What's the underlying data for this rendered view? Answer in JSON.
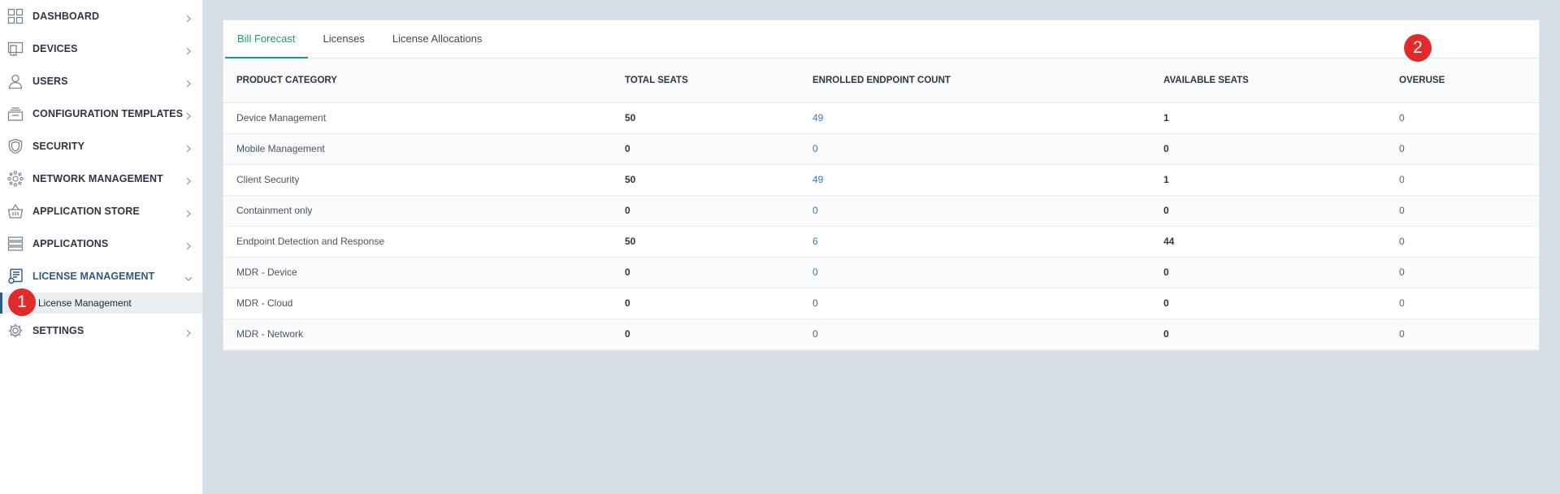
{
  "sidebar": {
    "items": [
      {
        "label": "DASHBOARD",
        "icon": "dashboard-icon"
      },
      {
        "label": "DEVICES",
        "icon": "devices-icon"
      },
      {
        "label": "USERS",
        "icon": "user-icon"
      },
      {
        "label": "CONFIGURATION TEMPLATES",
        "icon": "templates-icon"
      },
      {
        "label": "SECURITY",
        "icon": "shield-icon"
      },
      {
        "label": "NETWORK MANAGEMENT",
        "icon": "network-icon"
      },
      {
        "label": "APPLICATION STORE",
        "icon": "basket-icon"
      },
      {
        "label": "APPLICATIONS",
        "icon": "applications-icon"
      },
      {
        "label": "LICENSE MANAGEMENT",
        "icon": "license-icon"
      },
      {
        "label": "SETTINGS",
        "icon": "gear-icon"
      }
    ],
    "sub_item": {
      "label": "License Management"
    }
  },
  "badges": {
    "one": "1",
    "two": "2"
  },
  "tabs": [
    {
      "label": "Bill Forecast",
      "active": true
    },
    {
      "label": "Licenses",
      "active": false
    },
    {
      "label": "License Allocations",
      "active": false
    }
  ],
  "table": {
    "headers": [
      "PRODUCT CATEGORY",
      "TOTAL SEATS",
      "ENROLLED ENDPOINT COUNT",
      "AVAILABLE SEATS",
      "OVERUSE"
    ],
    "rows": [
      [
        "Device Management",
        "50",
        "49",
        "1",
        "0"
      ],
      [
        "Mobile Management",
        "0",
        "0",
        "0",
        "0"
      ],
      [
        "Client Security",
        "50",
        "49",
        "1",
        "0"
      ],
      [
        "Containment only",
        "0",
        "0",
        "0",
        "0"
      ],
      [
        "Endpoint Detection and Response",
        "50",
        "6",
        "44",
        "0"
      ],
      [
        "MDR - Device",
        "0",
        "0",
        "0",
        "0"
      ],
      [
        "MDR - Cloud",
        "0",
        "0",
        "0",
        "0"
      ],
      [
        "MDR - Network",
        "0",
        "0",
        "0",
        "0"
      ]
    ]
  },
  "colors": {
    "accent_green": "#1e9b78",
    "link_blue": "#3a78b9",
    "active_nav": "#2f5a86",
    "badge_red": "#e02b2b",
    "background": "#d7dee6"
  }
}
